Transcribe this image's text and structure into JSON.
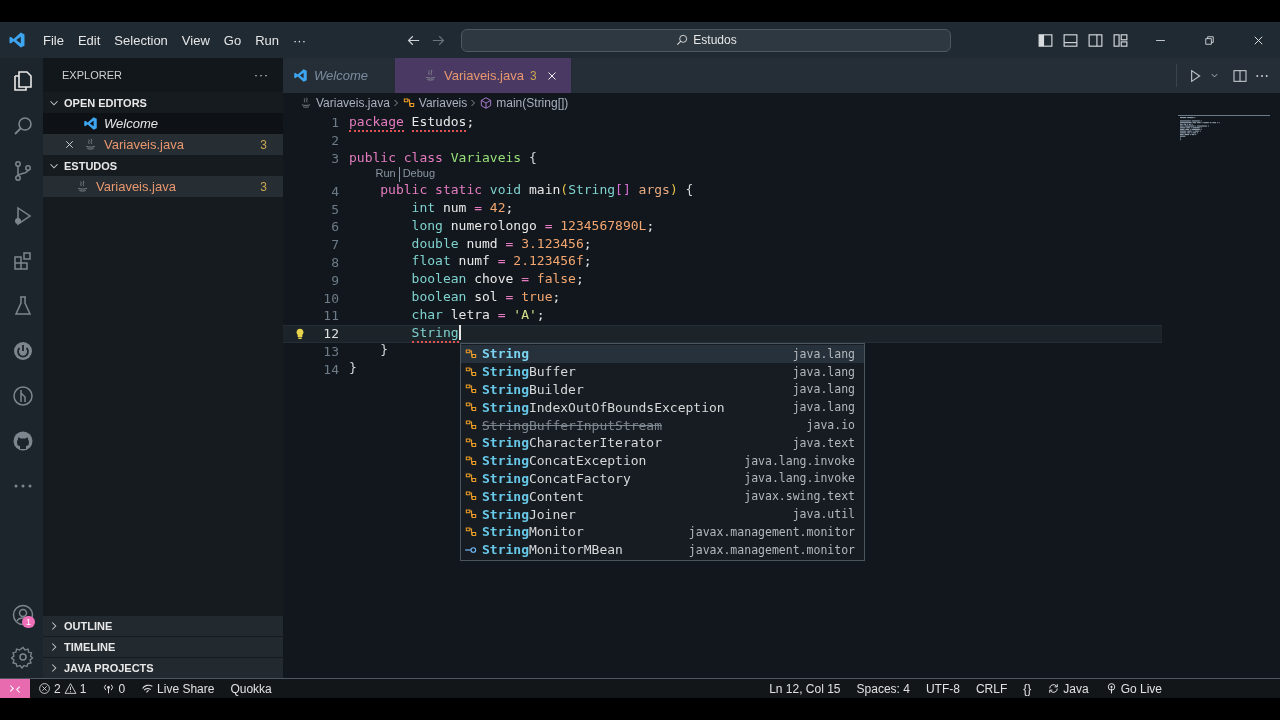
{
  "menu": [
    "File",
    "Edit",
    "Selection",
    "View",
    "Go",
    "Run",
    "···"
  ],
  "command_center": {
    "value": "Estudos"
  },
  "activity_bar": {
    "items": [
      {
        "selected": true
      },
      {
        "selected": false
      },
      {
        "selected": false
      },
      {
        "selected": false
      },
      {
        "selected": false
      },
      {
        "selected": false
      },
      {
        "selected": false
      },
      {
        "selected": false
      },
      {
        "selected": false
      },
      {
        "selected": false
      }
    ],
    "account_badge": "1"
  },
  "sidebar": {
    "title": "EXPLORER",
    "more": "···",
    "sections": [
      {
        "title": "OPEN EDITORS",
        "expanded": true,
        "items": [
          {
            "label": "Welcome",
            "kind": "welcome",
            "preview": true,
            "close": false,
            "selected": true
          },
          {
            "label": "Variaveis.java",
            "kind": "java",
            "preview": false,
            "close": true,
            "badge": "3",
            "selected": false
          }
        ]
      },
      {
        "title": "ESTUDOS",
        "expanded": true,
        "items": [
          {
            "label": "Variaveis.java",
            "kind": "java",
            "preview": false,
            "close": false,
            "badge": "3",
            "selected": false
          }
        ]
      }
    ],
    "bottom_sections": [
      {
        "title": "OUTLINE",
        "expanded": false
      },
      {
        "title": "TIMELINE",
        "expanded": false
      },
      {
        "title": "JAVA PROJECTS",
        "expanded": false
      }
    ]
  },
  "tabs": [
    {
      "label": "Welcome",
      "kind": "welcome",
      "preview": true,
      "selected": false
    },
    {
      "label": "Variaveis.java",
      "kind": "java",
      "preview": false,
      "badge": "3",
      "selected": true
    }
  ],
  "breadcrumb": [
    {
      "label": "Variaveis.java",
      "kind": "java"
    },
    {
      "label": "Variaveis",
      "kind": "class"
    },
    {
      "label": "main(String[])",
      "kind": "method"
    }
  ],
  "code": {
    "lines": [
      {
        "number": "1",
        "current": false,
        "tokens": [
          {
            "text": "package",
            "kind": "keyword",
            "error": true
          },
          {
            "text": "Estudos",
            "kind": "ident",
            "error": true
          },
          {
            "text": ";",
            "kind": "punct",
            "attached": true
          }
        ]
      },
      {
        "number": "2",
        "current": false
      },
      {
        "number": "3",
        "current": false,
        "tokens": [
          {
            "text": "public class",
            "kind": "keyword"
          },
          {
            "text": "Variaveis",
            "kind": "class"
          },
          {
            "text": "{",
            "kind": "open"
          }
        ]
      },
      {
        "number": "4",
        "current": false,
        "codelens": [
          "Run",
          "Debug"
        ],
        "tokens": [
          {
            "text": "public static",
            "kind": "keyword"
          },
          {
            "text": "void",
            "kind": "type"
          },
          {
            "text": "main",
            "kind": "ident"
          },
          {
            "text": "(",
            "kind": "bracket",
            "attached": true
          },
          {
            "text": "String",
            "kind": "type",
            "attached": true
          },
          {
            "text": "[]",
            "kind": "bracket2",
            "attached": true
          },
          {
            "text": "args",
            "kind": "param"
          },
          {
            "text": ")",
            "kind": "bracket",
            "attached": true
          },
          {
            "text": "{",
            "kind": "open"
          }
        ]
      },
      {
        "number": "5",
        "current": false,
        "tokens": [
          {
            "text": "int",
            "kind": "type"
          },
          {
            "text": "num",
            "kind": "ident"
          },
          {
            "text": "=",
            "kind": "op"
          },
          {
            "text": "42",
            "kind": "number"
          },
          {
            "text": ";",
            "kind": "punct",
            "attached": true
          }
        ]
      },
      {
        "number": "6",
        "current": false,
        "tokens": [
          {
            "text": "long",
            "kind": "type"
          },
          {
            "text": "numerolongo",
            "kind": "ident"
          },
          {
            "text": "=",
            "kind": "op"
          },
          {
            "text": "1234567890L",
            "kind": "number"
          },
          {
            "text": ";",
            "kind": "punct",
            "attached": true
          }
        ]
      },
      {
        "number": "7",
        "current": false,
        "tokens": [
          {
            "text": "double",
            "kind": "type"
          },
          {
            "text": "numd",
            "kind": "ident"
          },
          {
            "text": "=",
            "kind": "op"
          },
          {
            "text": "3.123456",
            "kind": "number"
          },
          {
            "text": ";",
            "kind": "punct",
            "attached": true
          }
        ]
      },
      {
        "number": "8",
        "current": false,
        "tokens": [
          {
            "text": "float",
            "kind": "type"
          },
          {
            "text": "numf",
            "kind": "ident"
          },
          {
            "text": "=",
            "kind": "op"
          },
          {
            "text": "2.123456f",
            "kind": "number"
          },
          {
            "text": ";",
            "kind": "punct",
            "attached": true
          }
        ]
      },
      {
        "number": "9",
        "current": false,
        "tokens": [
          {
            "text": "boolean",
            "kind": "type"
          },
          {
            "text": "chove",
            "kind": "ident"
          },
          {
            "text": "=",
            "kind": "op"
          },
          {
            "text": "false",
            "kind": "number"
          },
          {
            "text": ";",
            "kind": "punct",
            "attached": true
          }
        ]
      },
      {
        "number": "10",
        "current": false,
        "tokens": [
          {
            "text": "boolean",
            "kind": "type"
          },
          {
            "text": "sol",
            "kind": "ident"
          },
          {
            "text": "=",
            "kind": "op"
          },
          {
            "text": "true",
            "kind": "number"
          },
          {
            "text": ";",
            "kind": "punct",
            "attached": true
          }
        ]
      },
      {
        "number": "11",
        "current": false,
        "tokens": [
          {
            "text": "char",
            "kind": "type"
          },
          {
            "text": "letra",
            "kind": "ident"
          },
          {
            "text": "=",
            "kind": "op"
          },
          {
            "text": "'A'",
            "kind": "string"
          },
          {
            "text": ";",
            "kind": "punct",
            "attached": true
          }
        ]
      },
      {
        "number": "12",
        "current": true,
        "lightbulb": true,
        "tokens": [
          {
            "text": "String",
            "kind": "type",
            "error": true
          }
        ]
      },
      {
        "number": "13",
        "current": false,
        "tokens": [
          {
            "text": "}",
            "kind": "close"
          }
        ]
      },
      {
        "number": "14",
        "current": false,
        "tokens": [
          {
            "text": "}",
            "kind": "close"
          }
        ]
      }
    ]
  },
  "suggestions": [
    {
      "label": "**String**",
      "detail": "java.lang",
      "kind": "class",
      "deprecated": false,
      "selected": true
    },
    {
      "label": "**String**Buffer",
      "detail": "java.lang",
      "kind": "class",
      "deprecated": false,
      "selected": false
    },
    {
      "label": "**String**Builder",
      "detail": "java.lang",
      "kind": "class",
      "deprecated": false,
      "selected": false
    },
    {
      "label": "**String**IndexOutOfBoundsException",
      "detail": "java.lang",
      "kind": "class",
      "deprecated": false,
      "selected": false
    },
    {
      "label": "StringBufferInputStream",
      "detail": "java.io",
      "kind": "class",
      "deprecated": true,
      "selected": false
    },
    {
      "label": "**String**CharacterIterator",
      "detail": "java.text",
      "kind": "class",
      "deprecated": false,
      "selected": false
    },
    {
      "label": "**String**ConcatException",
      "detail": "java.lang.invoke",
      "kind": "class",
      "deprecated": false,
      "selected": false
    },
    {
      "label": "**String**ConcatFactory",
      "detail": "java.lang.invoke",
      "kind": "class",
      "deprecated": false,
      "selected": false
    },
    {
      "label": "**String**Content",
      "detail": "javax.swing.text",
      "kind": "class",
      "deprecated": false,
      "selected": false
    },
    {
      "label": "**String**Joiner",
      "detail": "java.util",
      "kind": "class",
      "deprecated": false,
      "selected": false
    },
    {
      "label": "**String**Monitor",
      "detail": "javax.management.monitor",
      "kind": "class",
      "deprecated": false,
      "selected": false
    },
    {
      "label": "**String**MonitorMBean",
      "detail": "javax.management.monitor",
      "kind": "interface",
      "deprecated": false,
      "selected": false
    }
  ],
  "status_bar": {
    "left": [
      {
        "kind": "errors",
        "errors": "2",
        "warnings": "1"
      },
      {
        "kind": "ports",
        "text": "0"
      },
      {
        "kind": "liveshare",
        "text": "Live Share"
      },
      {
        "kind": "plain",
        "text": "Quokka"
      }
    ],
    "right": [
      {
        "kind": "plain",
        "text": "Ln 12, Col 15"
      },
      {
        "kind": "plain",
        "text": "Spaces: 4"
      },
      {
        "kind": "plain",
        "text": "UTF-8"
      },
      {
        "kind": "plain",
        "text": "CRLF"
      },
      {
        "kind": "braces",
        "text": "{}"
      },
      {
        "kind": "sync",
        "text": "Java"
      },
      {
        "kind": "golive",
        "text": "Go Live"
      }
    ]
  }
}
